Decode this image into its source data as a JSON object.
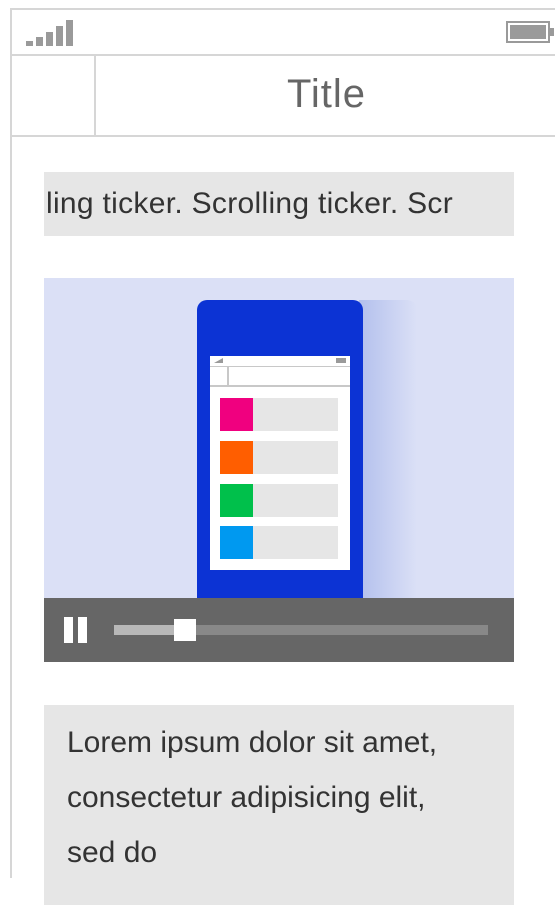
{
  "status_bar": {
    "signal_icon": "signal-strength-icon",
    "battery_icon": "battery-full-icon"
  },
  "nav": {
    "title": "Title"
  },
  "ticker": {
    "text": "ling ticker. Scrolling ticker. Scr"
  },
  "video": {
    "thumbnail_icon": "phone-list-illustration-icon",
    "list_colors": [
      "#f0007f",
      "#ff5e00",
      "#00c04b",
      "#0099f0"
    ],
    "phone_color": "#0c33d4",
    "background_color": "#dbe0f6",
    "controls": {
      "pause_icon": "pause-icon",
      "progress": 0.16
    }
  },
  "body_text": {
    "text": "Lorem ipsum dolor sit amet, consectetur adipisicing elit, sed do"
  }
}
